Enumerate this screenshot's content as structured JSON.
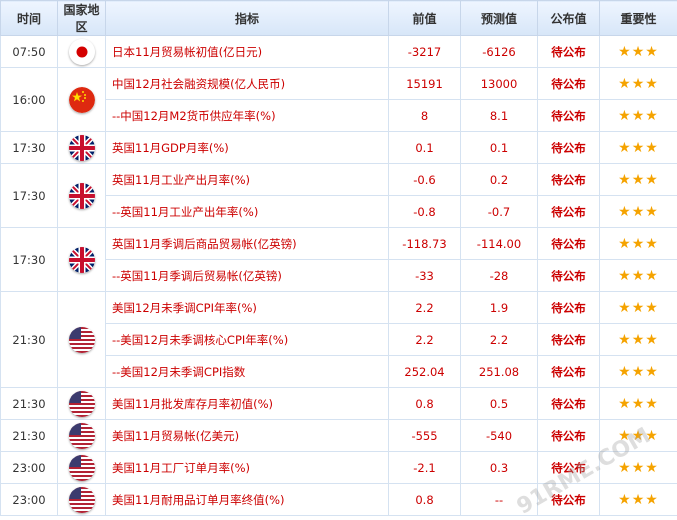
{
  "headers": {
    "time": "时间",
    "country": "国家地区",
    "indicator": "指标",
    "prev": "前值",
    "forecast": "预测值",
    "published": "公布值",
    "importance": "重要性"
  },
  "groups": [
    {
      "time": "07:50",
      "flag": "japan-flag-icon",
      "rows": [
        {
          "indicator": "日本11月贸易帐初值(亿日元)",
          "prev": "-3217",
          "forecast": "-6126",
          "published": "待公布",
          "stars": "★★★"
        }
      ]
    },
    {
      "time": "16:00",
      "flag": "china-flag-icon",
      "rows": [
        {
          "indicator": "中国12月社会融资规模(亿人民币)",
          "prev": "15191",
          "forecast": "13000",
          "published": "待公布",
          "stars": "★★★"
        },
        {
          "indicator": "--中国12月M2货币供应年率(%)",
          "prev": "8",
          "forecast": "8.1",
          "published": "待公布",
          "stars": "★★★"
        }
      ]
    },
    {
      "time": "17:30",
      "flag": "uk-flag-icon",
      "rows": [
        {
          "indicator": "英国11月GDP月率(%)",
          "prev": "0.1",
          "forecast": "0.1",
          "published": "待公布",
          "stars": "★★★"
        }
      ]
    },
    {
      "time": "17:30",
      "flag": "uk-flag-icon",
      "rows": [
        {
          "indicator": "英国11月工业产出月率(%)",
          "prev": "-0.6",
          "forecast": "0.2",
          "published": "待公布",
          "stars": "★★★"
        },
        {
          "indicator": "--英国11月工业产出年率(%)",
          "prev": "-0.8",
          "forecast": "-0.7",
          "published": "待公布",
          "stars": "★★★"
        }
      ]
    },
    {
      "time": "17:30",
      "flag": "uk-flag-icon",
      "rows": [
        {
          "indicator": "英国11月季调后商品贸易帐(亿英镑)",
          "prev": "-118.73",
          "forecast": "-114.00",
          "published": "待公布",
          "stars": "★★★"
        },
        {
          "indicator": "--英国11月季调后贸易帐(亿英镑)",
          "prev": "-33",
          "forecast": "-28",
          "published": "待公布",
          "stars": "★★★"
        }
      ]
    },
    {
      "time": "21:30",
      "flag": "us-flag-icon",
      "rows": [
        {
          "indicator": "美国12月未季调CPI年率(%)",
          "prev": "2.2",
          "forecast": "1.9",
          "published": "待公布",
          "stars": "★★★"
        },
        {
          "indicator": "--美国12月未季调核心CPI年率(%)",
          "prev": "2.2",
          "forecast": "2.2",
          "published": "待公布",
          "stars": "★★★"
        },
        {
          "indicator": "--美国12月未季调CPI指数",
          "prev": "252.04",
          "forecast": "251.08",
          "published": "待公布",
          "stars": "★★★"
        }
      ]
    },
    {
      "time": "21:30",
      "flag": "us-flag-icon",
      "rows": [
        {
          "indicator": "美国11月批发库存月率初值(%)",
          "prev": "0.8",
          "forecast": "0.5",
          "published": "待公布",
          "stars": "★★★"
        }
      ]
    },
    {
      "time": "21:30",
      "flag": "us-flag-icon",
      "rows": [
        {
          "indicator": "美国11月贸易帐(亿美元)",
          "prev": "-555",
          "forecast": "-540",
          "published": "待公布",
          "stars": "★★★"
        }
      ]
    },
    {
      "time": "23:00",
      "flag": "us-flag-icon",
      "rows": [
        {
          "indicator": "美国11月工厂订单月率(%)",
          "prev": "-2.1",
          "forecast": "0.3",
          "published": "待公布",
          "stars": "★★★"
        }
      ]
    },
    {
      "time": "23:00",
      "flag": "us-flag-icon",
      "rows": [
        {
          "indicator": "美国11月耐用品订单月率终值(%)",
          "prev": "0.8",
          "forecast": "--",
          "published": "待公布",
          "stars": "★★★"
        }
      ]
    }
  ]
}
